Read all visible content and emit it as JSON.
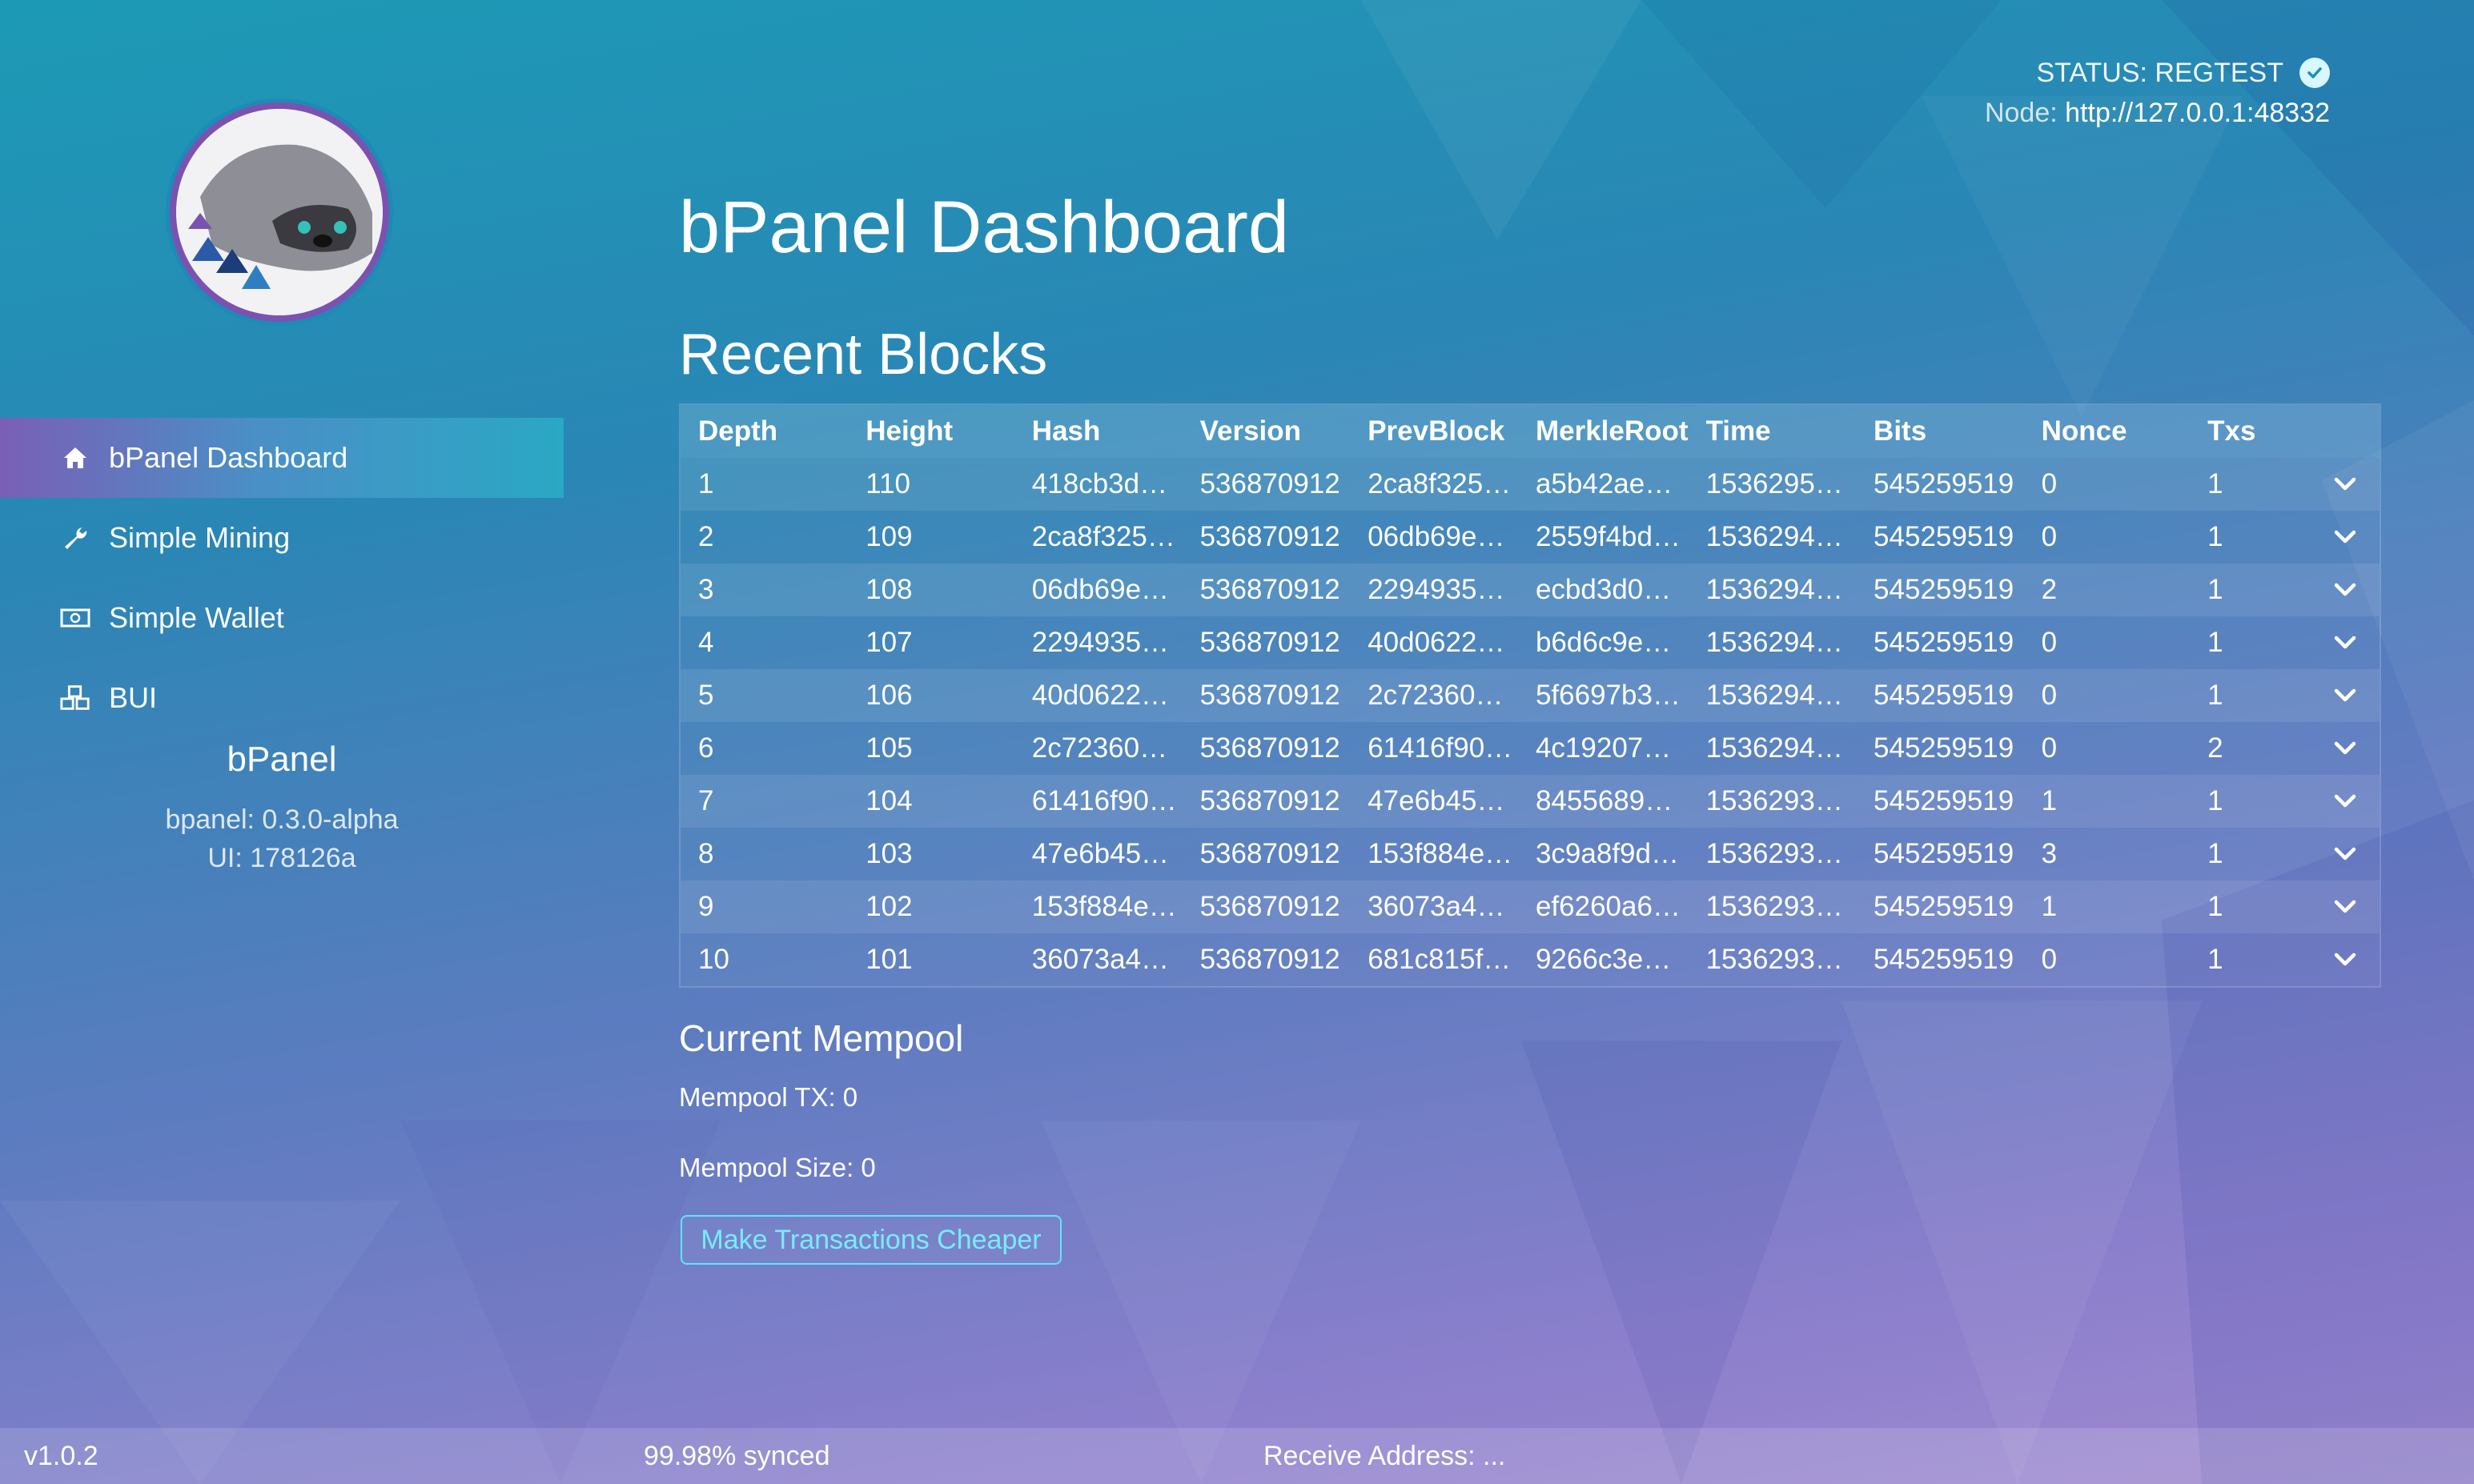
{
  "status": {
    "label": "STATUS: REGTEST",
    "node_label": "Node:",
    "node_url": "http://127.0.0.1:48332"
  },
  "sidebar": {
    "items": [
      {
        "label": "bPanel Dashboard",
        "icon": "home-icon",
        "active": true
      },
      {
        "label": "Simple Mining",
        "icon": "wrench-icon",
        "active": false
      },
      {
        "label": "Simple Wallet",
        "icon": "money-icon",
        "active": false
      },
      {
        "label": "BUI",
        "icon": "cubes-icon",
        "active": false
      }
    ],
    "app_name": "bPanel",
    "bpanel_version": "bpanel: 0.3.0-alpha",
    "ui_version": "UI: 178126a"
  },
  "main": {
    "title": "bPanel Dashboard",
    "recent_blocks_title": "Recent Blocks",
    "columns": [
      "Depth",
      "Height",
      "Hash",
      "Version",
      "PrevBlock",
      "MerkleRoot",
      "Time",
      "Bits",
      "Nonce",
      "Txs"
    ],
    "rows": [
      [
        "1",
        "110",
        "418cb3d…",
        "536870912",
        "2ca8f325…",
        "a5b42ae…",
        "1536295…",
        "545259519",
        "0",
        "1"
      ],
      [
        "2",
        "109",
        "2ca8f325…",
        "536870912",
        "06db69e…",
        "2559f4bd…",
        "1536294…",
        "545259519",
        "0",
        "1"
      ],
      [
        "3",
        "108",
        "06db69e…",
        "536870912",
        "2294935…",
        "ecbd3d0…",
        "1536294…",
        "545259519",
        "2",
        "1"
      ],
      [
        "4",
        "107",
        "2294935…",
        "536870912",
        "40d0622…",
        "b6d6c9e…",
        "1536294…",
        "545259519",
        "0",
        "1"
      ],
      [
        "5",
        "106",
        "40d0622…",
        "536870912",
        "2c72360…",
        "5f6697b3…",
        "1536294…",
        "545259519",
        "0",
        "1"
      ],
      [
        "6",
        "105",
        "2c72360…",
        "536870912",
        "61416f90…",
        "4c19207…",
        "1536294…",
        "545259519",
        "0",
        "2"
      ],
      [
        "7",
        "104",
        "61416f90…",
        "536870912",
        "47e6b45…",
        "8455689…",
        "1536293…",
        "545259519",
        "1",
        "1"
      ],
      [
        "8",
        "103",
        "47e6b45…",
        "536870912",
        "153f884e…",
        "3c9a8f9d…",
        "1536293…",
        "545259519",
        "3",
        "1"
      ],
      [
        "9",
        "102",
        "153f884e…",
        "536870912",
        "36073a4…",
        "ef6260a6…",
        "1536293…",
        "545259519",
        "1",
        "1"
      ],
      [
        "10",
        "101",
        "36073a4…",
        "536870912",
        "681c815f…",
        "9266c3e…",
        "1536293…",
        "545259519",
        "0",
        "1"
      ]
    ],
    "mempool_title": "Current Mempool",
    "mempool_tx": "Mempool TX: 0",
    "mempool_size": "Mempool Size: 0",
    "cheaper_button": "Make Transactions Cheaper"
  },
  "footer": {
    "version": "v1.0.2",
    "sync": "99.98% synced",
    "receive": "Receive Address: ..."
  },
  "colors": {
    "accent_button": "#5ee6ff",
    "active_nav_start": "#7a5fb6",
    "active_nav_end": "#2aa8c4"
  }
}
